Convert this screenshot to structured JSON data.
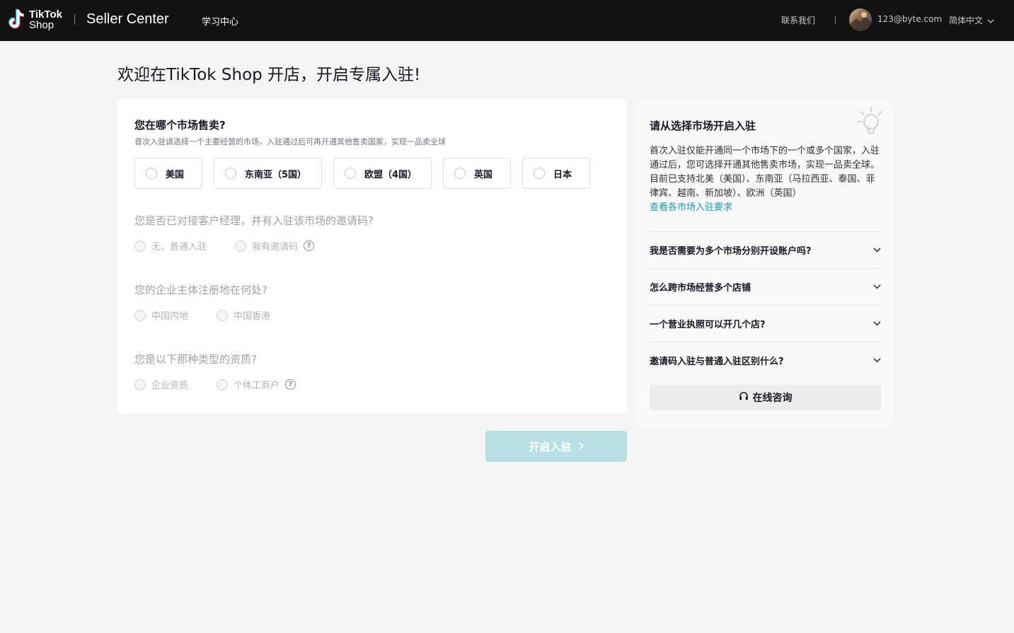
{
  "header": {
    "logo_line1": "TikTok",
    "logo_line2": "Shop",
    "brand": "Seller Center",
    "learning_center": "学习中心",
    "contact": "联系我们",
    "email": "123@byte.com",
    "language": "简体中文"
  },
  "page_title": "欢迎在TikTok Shop 开店，开启专属入驻!",
  "form": {
    "market_question": "您在哪个市场售卖?",
    "market_hint": "首次入驻请选择一个主要经营的市场，入驻通过后可再开通其他售卖国家，实现一品卖全球",
    "markets": [
      "美国",
      "东南亚（5国）",
      "欧盟（4国）",
      "英国",
      "日本"
    ],
    "invite_question": "您是否已对接客户经理，并有入驻该市场的邀请码?",
    "invite_options": [
      "无，普通入驻",
      "我有邀请码"
    ],
    "region_question": "您的企业主体注册地在何处?",
    "region_options": [
      "中国内地",
      "中国香港"
    ],
    "type_question": "您是以下那种类型的资质?",
    "type_options": [
      "企业资质",
      "个体工商户"
    ],
    "help_glyph": "?",
    "submit_label": "开启入驻"
  },
  "side": {
    "title": "请从选择市场开启入驻",
    "description": "首次入驻仅能开通同一个市场下的一个或多个国家，入驻通过后，您可选择开通其他售卖市场，实现一品卖全球。目前已支持北美（美国）、东南亚（马拉西亚、泰国、菲律宾、越南、新加坡）、欧洲（英国）",
    "link": "查看各市场入驻要求",
    "faqs": [
      "我是否需要为多个市场分别开设账户吗?",
      "怎么跨市场经营多个店铺",
      "一个营业执照可以开几个店?",
      "邀请码入驻与普通入驻区别什么?"
    ],
    "consult_label": "在线咨询"
  },
  "colors": {
    "accent": "#1a9ca5",
    "disabled_button": "#b8e0e2",
    "header_bg": "#121212"
  },
  "icons": {
    "logo": "tiktok-note-icon",
    "chevron": "chevron-down-icon",
    "consult": "headset-icon",
    "side": "lightbulb-icon",
    "help": "question-circle-icon"
  }
}
